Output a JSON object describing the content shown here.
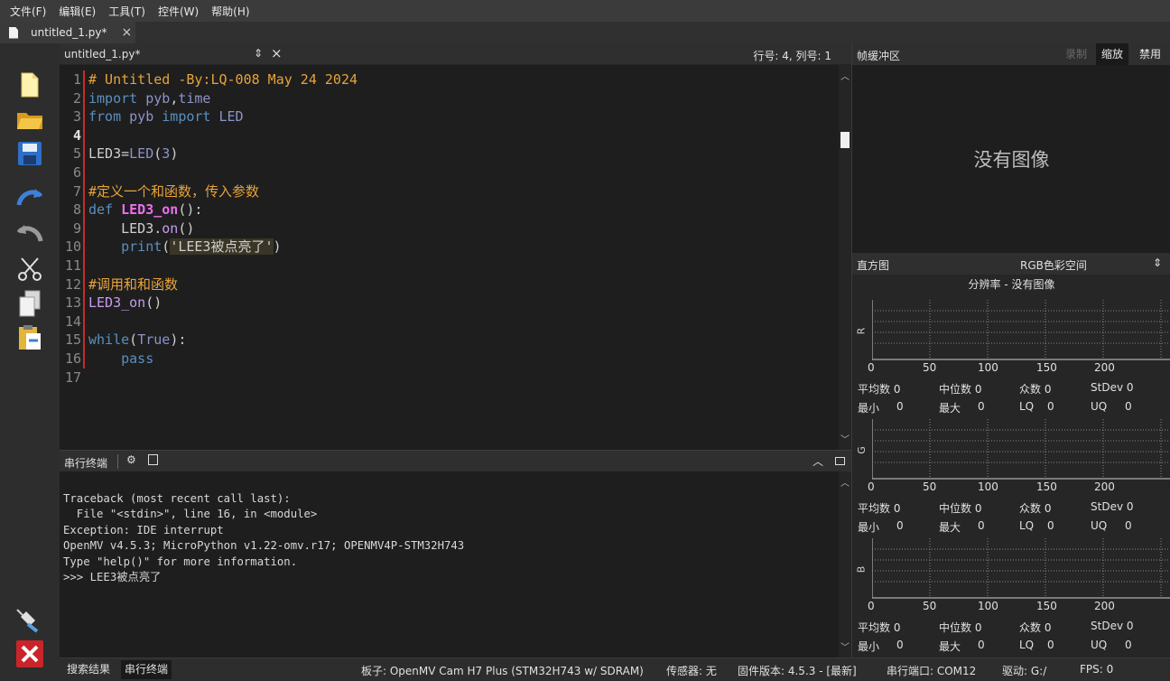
{
  "menu": [
    "文件(F)",
    "编辑(E)",
    "工具(T)",
    "控件(W)",
    "帮助(H)"
  ],
  "file_tab": {
    "label": "untitled_1.py*",
    "close": "×"
  },
  "editor": {
    "filename": "untitled_1.py*",
    "position": "行号: 4, 列号: 1",
    "line_numbers": [
      "1",
      "2",
      "3",
      "4",
      "5",
      "6",
      "7",
      "8",
      "9",
      "10",
      "11",
      "12",
      "13",
      "14",
      "15",
      "16",
      "17"
    ],
    "current_line": "4"
  },
  "serial_terminal": {
    "title": "串行终端",
    "lines": [
      "Traceback (most recent call last):",
      "  File \"<stdin>\", line 16, in <module>",
      "Exception: IDE interrupt",
      "OpenMV v4.5.3; MicroPython v1.22-omv.r17; OPENMV4P-STM32H743",
      "Type \"help()\" for more information.",
      ">>> LEE3被点亮了"
    ]
  },
  "framebuffer": {
    "title": "帧缓冲区",
    "record_label": "录制",
    "zoom_label": "缩放",
    "disable_label": "禁用",
    "no_image": "没有图像"
  },
  "histogram": {
    "title": "直方图",
    "color_space": "RGB色彩空间",
    "resolution": "分辨率 - 没有图像",
    "ticks": [
      "0",
      "50",
      "100",
      "150",
      "200"
    ],
    "channels": [
      {
        "label": "R",
        "mean": "平均数 0",
        "median": "中位数 0",
        "mode": "众数 0",
        "stdev": "StDev 0",
        "min": "最小",
        "min_v": "0",
        "max": "最大",
        "max_v": "0",
        "lq": "LQ",
        "lq_v": "0",
        "uq": "UQ",
        "uq_v": "0"
      },
      {
        "label": "G",
        "mean": "平均数 0",
        "median": "中位数 0",
        "mode": "众数 0",
        "stdev": "StDev 0",
        "min": "最小",
        "min_v": "0",
        "max": "最大",
        "max_v": "0",
        "lq": "LQ",
        "lq_v": "0",
        "uq": "UQ",
        "uq_v": "0"
      },
      {
        "label": "B",
        "mean": "平均数 0",
        "median": "中位数 0",
        "mode": "众数 0",
        "stdev": "StDev 0",
        "min": "最小",
        "min_v": "0",
        "max": "最大",
        "max_v": "0",
        "lq": "LQ",
        "lq_v": "0",
        "uq": "UQ",
        "uq_v": "0"
      }
    ]
  },
  "status": {
    "search_results": "搜索结果",
    "serial_tab": "串行终端",
    "board": "板子: OpenMV Cam H7 Plus (STM32H743 w/ SDRAM)",
    "sensor": "传感器: 无",
    "firmware": "固件版本: 4.5.3 - [最新]",
    "port": "串行端口: COM12",
    "drive": "驱动: G:/",
    "fps": "FPS: 0"
  },
  "toolbar_icons": [
    "new-file-icon",
    "open-folder-icon",
    "save-icon",
    "undo-icon",
    "redo-icon",
    "cut-icon",
    "copy-icon",
    "paste-icon",
    "connect-icon",
    "stop-icon"
  ],
  "colors": {
    "comment": "#e8a33a",
    "keyword": "#5a8fbf",
    "function_def": "#ee6ef0",
    "gutter_marker": "#c62c2c",
    "stop_button": "#c8242a"
  }
}
